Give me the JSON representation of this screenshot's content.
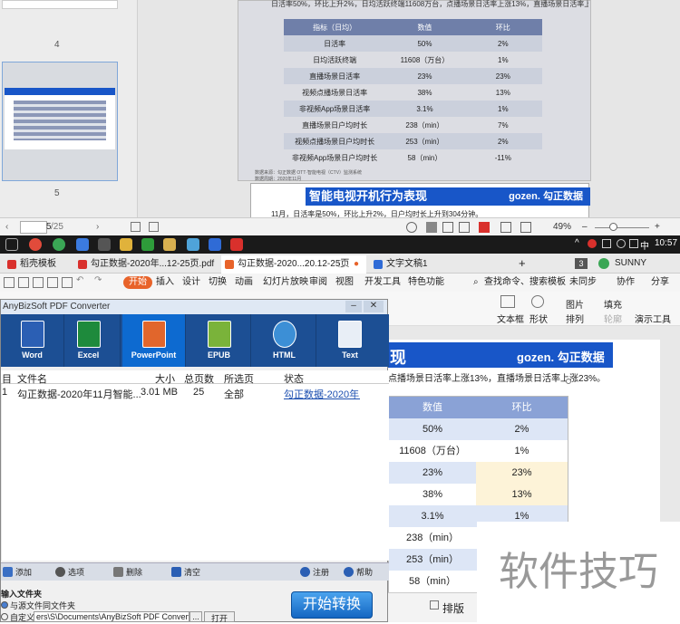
{
  "viewer": {
    "thumb_number": "4",
    "thumb_number_2": "5",
    "slide_caption": "日活率50%，环比上升2%，日均活跃终端11608万台，点播场景日活率上涨13%，直播场景日活率上涨23%。",
    "slide_table": {
      "headers": [
        "指标（日均）",
        "数值",
        "环比"
      ],
      "rows": [
        [
          "日活率",
          "50%",
          "2%"
        ],
        [
          "日均活跃终端",
          "11608（万台）",
          "1%"
        ],
        [
          "直播场景日活率",
          "23%",
          "23%"
        ],
        [
          "视频点播场景日活率",
          "38%",
          "13%"
        ],
        [
          "非视频App场景日活率",
          "3.1%",
          "1%"
        ],
        [
          "直播场景日户均时长",
          "238（min）",
          "7%"
        ],
        [
          "视频点播场景日户均时长",
          "253（min）",
          "2%"
        ],
        [
          "非视频App场景日户均时长",
          "58（min）",
          "-11%"
        ]
      ]
    },
    "slide_source": "数据来源：勾正数据 OTT·智能电视（CTV）监测系统",
    "slide_period": "数据周期：2020年11月",
    "slide2_title": "智能电视开机行为表现",
    "slide2_logo": "gozen. 勾正数据",
    "slide2_caption": "11月，日活率是50%，环比上升2%，日户均时长上升到304分钟。",
    "page_input": "5",
    "page_total": "/25",
    "zoom": "49%"
  },
  "taskbar": {
    "ime": "中",
    "time": "10:57"
  },
  "wps_tabs": {
    "tabs": [
      {
        "label": "稻壳模板",
        "color": "#d9302c"
      },
      {
        "label": "勾正数据-2020年...12-25页.pdf",
        "color": "#d9302c"
      },
      {
        "label": "勾正数据-2020...20.12-25页",
        "color": "#e8632a"
      },
      {
        "label": "文字文稿1",
        "color": "#2f6bd6"
      }
    ],
    "new_tab": "+",
    "badge": "3",
    "user": "SUNNY"
  },
  "wps_menu": {
    "items": [
      "开始",
      "插入",
      "设计",
      "切换",
      "动画",
      "幻灯片放映",
      "审阅",
      "视图",
      "开发工具",
      "特色功能"
    ],
    "search": "查找命令、搜索模板",
    "sync": "未同步",
    "collab": "协作",
    "share": "分享"
  },
  "wps_ribbon": {
    "items": [
      "文本框",
      "形状",
      "排列",
      "图片",
      "填充",
      "轮廓",
      "演示工具"
    ]
  },
  "pdf_converter": {
    "title": "AnyBizSoft PDF Converter",
    "formats": [
      "Word",
      "Excel",
      "PowerPoint",
      "EPUB",
      "HTML",
      "Text"
    ],
    "active_format": "PowerPoint",
    "columns": [
      "目",
      "文件名",
      "大小",
      "总页数",
      "所选页",
      "状态"
    ],
    "rows": [
      {
        "index": "1",
        "name": "勾正数据-2020年11月智能...",
        "size": "3.01 MB",
        "pages": "25",
        "selected": "全部",
        "status": "勾正数据-2020年..."
      }
    ],
    "buttons": [
      "添加",
      "选项",
      "删除",
      "清空",
      "注册",
      "帮助"
    ],
    "output_label": "输入文件夹",
    "option_same": "与源文件同文件夹",
    "option_custom": "自定义",
    "custom_path": "ers\\S\\Documents\\AnyBizSoft PDF Converter\\",
    "browse": "...",
    "open": "打开",
    "convert": "开始转换"
  },
  "document": {
    "banner_title": "现",
    "banner_logo": "gozen. 勾正数据",
    "caption": "点播场景日活率上涨13%，直播场景日活率上涨23%。",
    "table": {
      "headers": [
        "数值",
        "环比"
      ],
      "rows": [
        [
          "50%",
          "2%"
        ],
        [
          "11608（万台）",
          "1%"
        ],
        [
          "23%",
          "23%"
        ],
        [
          "38%",
          "13%"
        ],
        [
          "3.1%",
          "1%"
        ],
        [
          "238（min）",
          ""
        ],
        [
          "253（min）",
          ""
        ],
        [
          "58（min）",
          ""
        ]
      ]
    },
    "footer_button": "排版"
  },
  "watermark": "软件技巧"
}
